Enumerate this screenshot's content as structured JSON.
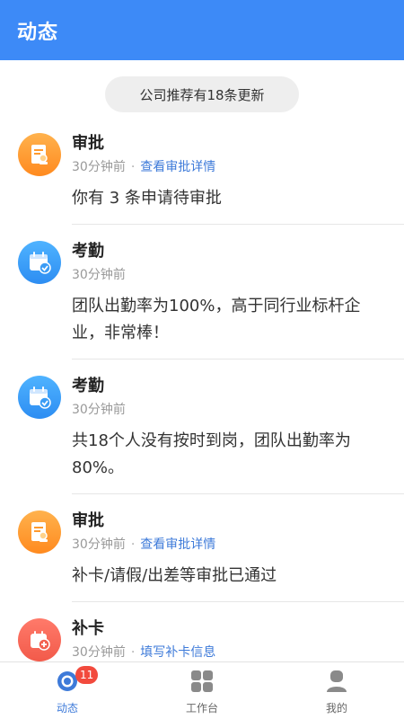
{
  "header": {
    "title": "动态"
  },
  "notice": {
    "text": "公司推荐有18条更新"
  },
  "feed": [
    {
      "title": "审批",
      "time": "30分钟前",
      "link": "查看审批详情",
      "body": "你有 3 条申请待审批",
      "icon": "approval-document-icon",
      "color": "#ff9a2e"
    },
    {
      "title": "考勤",
      "time": "30分钟前",
      "link": "",
      "body": "团队出勤率为100%，高于同行业标杆企业，非常棒！",
      "icon": "attendance-calendar-icon",
      "color": "#3b9cf5"
    },
    {
      "title": "考勤",
      "time": "30分钟前",
      "link": "",
      "body": "共18个人没有按时到岗，团队出勤率为80%。",
      "icon": "attendance-calendar-icon",
      "color": "#3b9cf5"
    },
    {
      "title": "审批",
      "time": "30分钟前",
      "link": "查看审批详情",
      "body": "补卡/请假/出差等审批已通过",
      "icon": "approval-document-icon",
      "color": "#ff9a2e"
    },
    {
      "title": "补卡",
      "time": "30分钟前",
      "link": "填写补卡信息",
      "body": "",
      "icon": "makeup-card-calendar-icon",
      "color": "#f2604f"
    }
  ],
  "tabbar": {
    "tabs": [
      {
        "label": "动态",
        "icon": "feed-icon",
        "badge": "11",
        "active": true
      },
      {
        "label": "工作台",
        "icon": "workbench-grid-icon",
        "badge": "",
        "active": false
      },
      {
        "label": "我的",
        "icon": "profile-icon",
        "badge": "",
        "active": false
      }
    ]
  },
  "colors": {
    "primary": "#3d8af7",
    "link": "#3d7ad9",
    "badge": "#f24a3d"
  }
}
